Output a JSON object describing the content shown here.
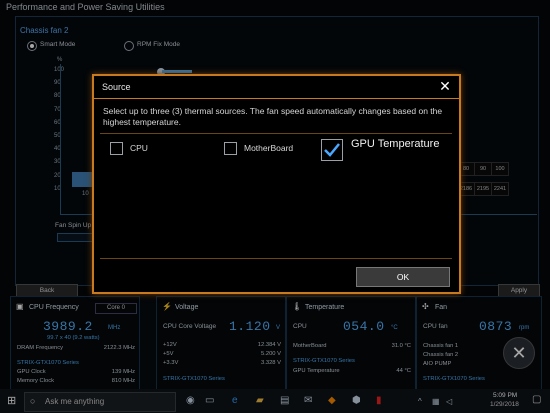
{
  "app": {
    "title": "Performance and Power Saving Utilities",
    "panel_title": "Chassis fan 2",
    "mode_smart": "Smart Mode",
    "mode_rpm": "RPM Fix Mode",
    "y_axis_unit": "%",
    "y_ticks": [
      "100",
      "90",
      "80",
      "70",
      "60",
      "50",
      "40",
      "30",
      "20",
      "10"
    ],
    "x_first": "10",
    "fan_spin_up": "Fan Spin Up",
    "table_top": [
      "80",
      "90",
      "100"
    ],
    "table_bottom": [
      "2186",
      "2195",
      "2241"
    ],
    "back_label": "Back",
    "apply_label": "Apply"
  },
  "modal": {
    "title": "Source",
    "description": "Select up to three (3) thermal sources. The fan speed automatically changes based on the highest temperature.",
    "options": [
      {
        "label": "CPU",
        "checked": false
      },
      {
        "label": "MotherBoard",
        "checked": false
      },
      {
        "label": "GPU Temperature",
        "checked": true
      }
    ],
    "ok_label": "OK"
  },
  "dashboard": {
    "cpu": {
      "title": "CPU Frequency",
      "core_select": "Core 0",
      "value": "3989.2",
      "unit": "MHz",
      "sub": "99.7 x 40 (9.2 watts)",
      "rows": [
        {
          "label": "DRAM Frequency",
          "value": "2122.3 MHz"
        },
        {
          "label": "STRIX-GTX1070 Series",
          "value": ""
        },
        {
          "label": "GPU Clock",
          "value": "139 MHz"
        },
        {
          "label": "Memory Clock",
          "value": "810 MHz"
        }
      ]
    },
    "voltage": {
      "title": "Voltage",
      "label": "CPU Core Voltage",
      "value": "1.120",
      "unit": "V",
      "rows": [
        {
          "label": "+12V",
          "value": "12.384 V"
        },
        {
          "label": "+5V",
          "value": "5.200 V"
        },
        {
          "label": "+3.3V",
          "value": "3.328 V"
        },
        {
          "label": "STRIX-GTX1070 Series",
          "value": ""
        }
      ]
    },
    "temperature": {
      "title": "Temperature",
      "label": "CPU",
      "value": "054.0",
      "unit": "°C",
      "rows": [
        {
          "label": "MotherBoard",
          "value": "31.0 °C"
        },
        {
          "label": "STRIX-GTX1070 Series",
          "value": ""
        },
        {
          "label": "GPU Temperature",
          "value": "44 °C"
        }
      ]
    },
    "fan": {
      "title": "Fan",
      "label": "CPU fan",
      "value": "0873",
      "unit": "rpm",
      "rows": [
        {
          "label": "Chassis fan 1",
          "value": ""
        },
        {
          "label": "Chassis fan 2",
          "value": ""
        },
        {
          "label": "AIO PUMP",
          "value": ""
        },
        {
          "label": "STRIX-GTX1070 Series",
          "value": ""
        }
      ]
    }
  },
  "taskbar": {
    "search_placeholder": "Ask me anything",
    "time": "5:09 PM",
    "date": "1/29/2018"
  },
  "colors": {
    "accent_blue": "#56b4ff",
    "modal_border": "#c97a1e"
  }
}
